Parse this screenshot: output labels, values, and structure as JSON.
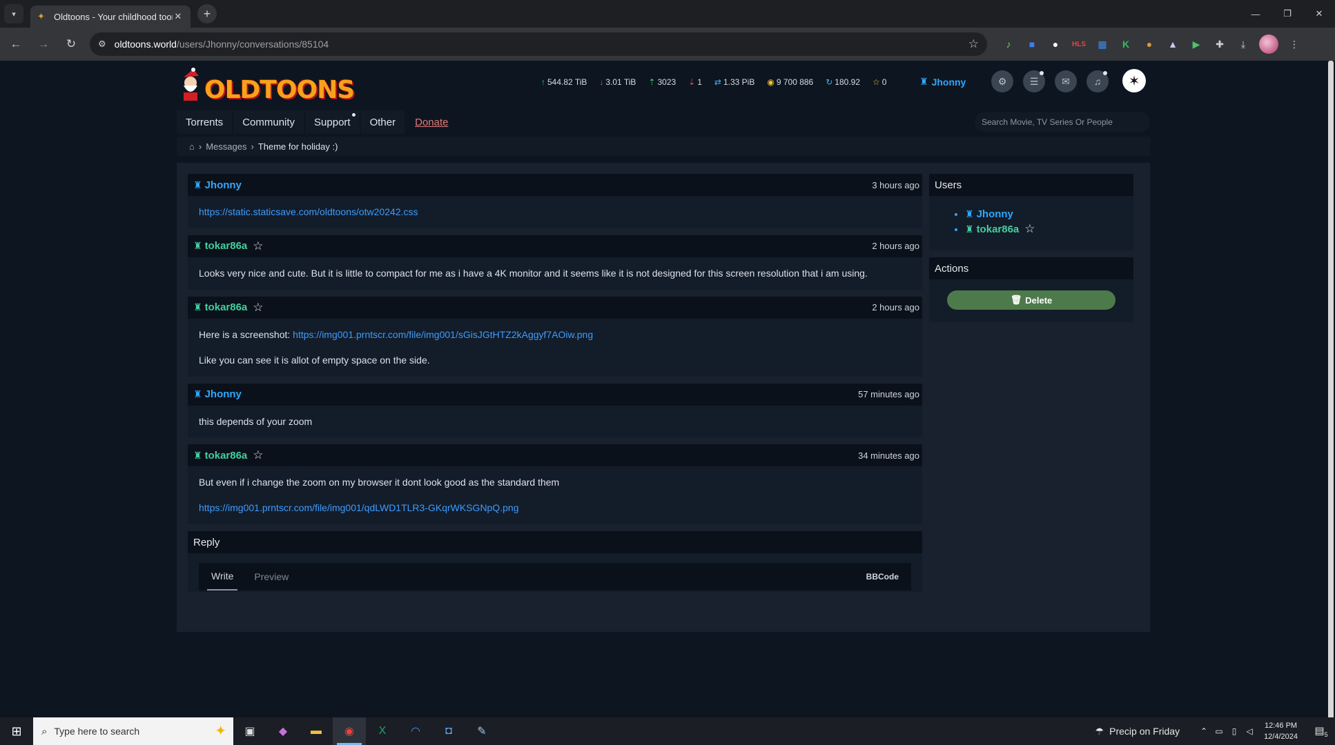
{
  "browser": {
    "tab_title": "Oldtoons - Your childhood toons",
    "url_host": "oldtoons.world",
    "url_path": "/users/Jhonny/conversations/85104"
  },
  "stats": {
    "upload": "544.82 TiB",
    "download": "3.01 TiB",
    "seeding": "3023",
    "leeching": "1",
    "ratio": "1.33 PiB",
    "bonus": "9 700 886",
    "buffer": "180.92",
    "freeleech_tokens": "0"
  },
  "header": {
    "logo_text": "OLDTOONS",
    "username": "Jhonny"
  },
  "nav": {
    "items": [
      "Torrents",
      "Community",
      "Support",
      "Other",
      "Donate"
    ],
    "search_placeholder": "Search Movie, TV Series Or People"
  },
  "breadcrumb": {
    "messages": "Messages",
    "current": "Theme for holiday :)"
  },
  "messages": [
    {
      "user": "Jhonny",
      "time": "3 hours ago",
      "link": "https://static.staticsave.com/oldtoons/otw20242.css"
    },
    {
      "user": "tokar86a",
      "time": "2 hours ago",
      "text": "Looks very nice and cute. But it is little to compact for me as i have a 4K monitor and it seems like it is not designed for this screen resolution that i am using."
    },
    {
      "user": "tokar86a",
      "time": "2 hours ago",
      "prefix": "Here is a screenshot: ",
      "link": "https://img001.prntscr.com/file/img001/sGisJGtHTZ2kAggyf7AOiw.png",
      "text2": "Like you can see it is allot of empty space on the side."
    },
    {
      "user": "Jhonny",
      "time": "57 minutes ago",
      "text": "this depends of your zoom"
    },
    {
      "user": "tokar86a",
      "time": "34 minutes ago",
      "text": "But even if i change the zoom on my browser it dont look good as the standard them",
      "link": "https://img001.prntscr.com/file/img001/qdLWD1TLR3-GKqrWKSGNpQ.png"
    }
  ],
  "reply": {
    "title": "Reply",
    "tab_write": "Write",
    "tab_preview": "Preview",
    "bbcode": "BBCode"
  },
  "sidebar": {
    "users_title": "Users",
    "users": [
      "Jhonny",
      "tokar86a"
    ],
    "actions_title": "Actions",
    "delete_label": "Delete"
  },
  "taskbar": {
    "search_placeholder": "Type here to search",
    "weather": "Precip on Friday",
    "time": "12:46 PM",
    "date": "12/4/2024",
    "notif_count": "5"
  }
}
